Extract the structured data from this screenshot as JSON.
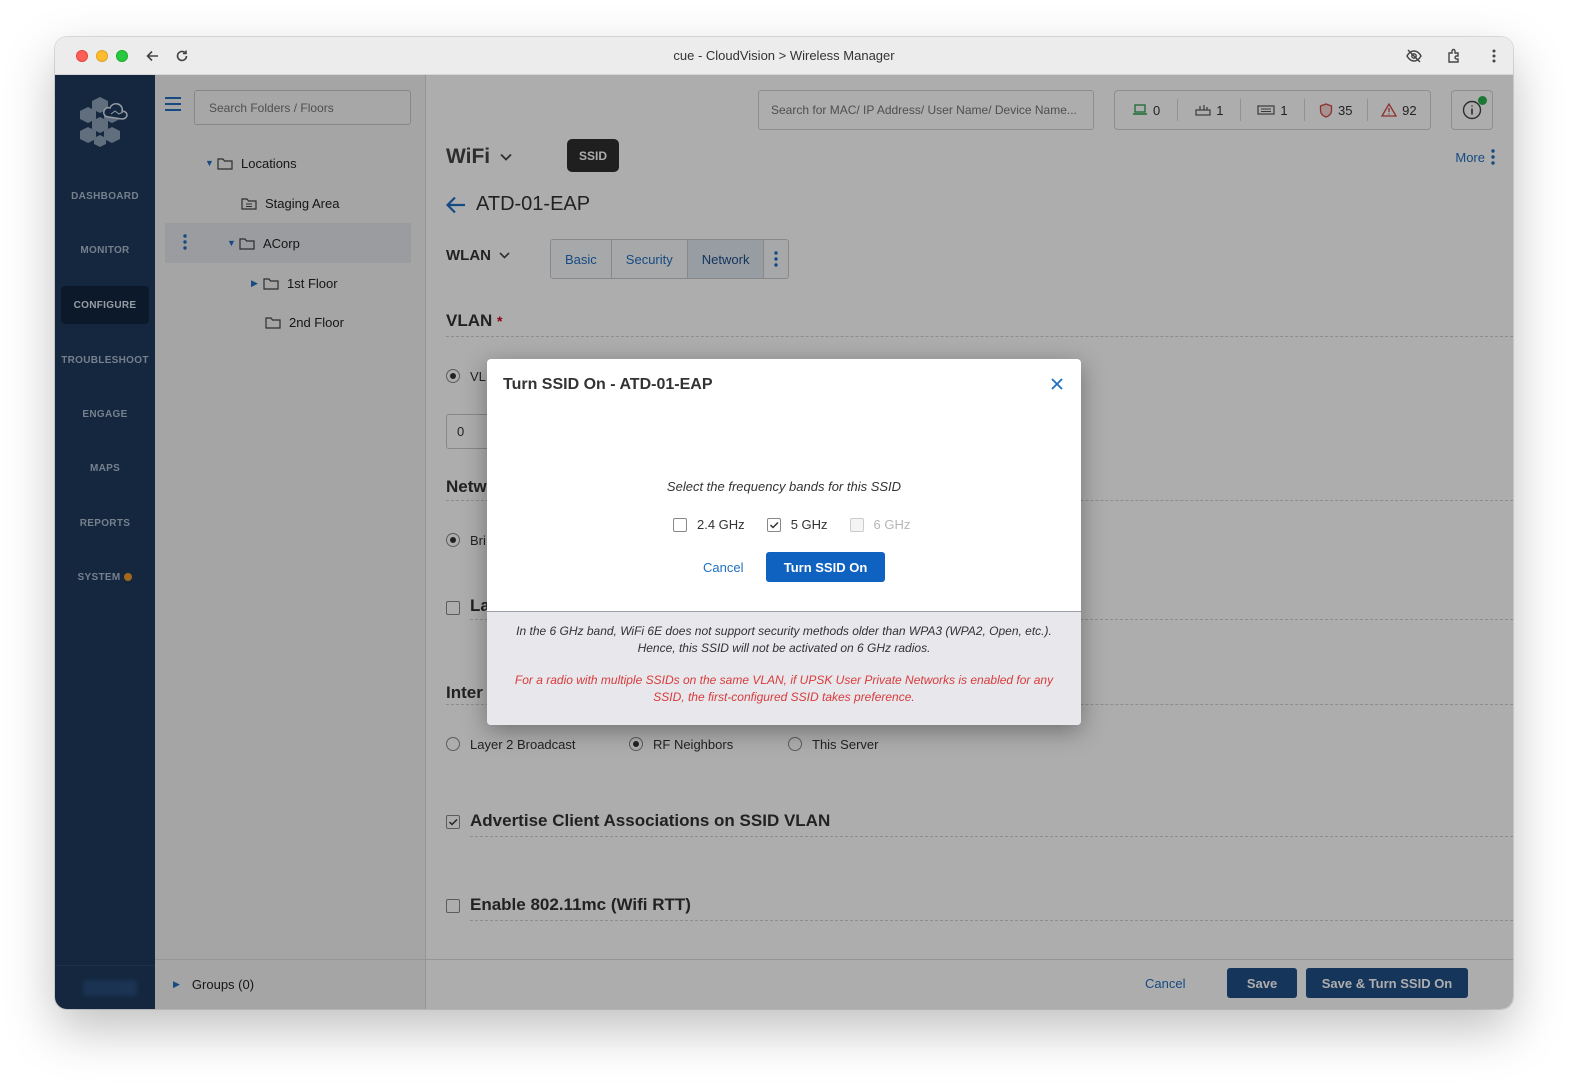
{
  "window": {
    "title": "cue - CloudVision > Wireless Manager"
  },
  "nav": {
    "items": [
      "DASHBOARD",
      "MONITOR",
      "CONFIGURE",
      "TROUBLESHOOT",
      "ENGAGE",
      "MAPS",
      "REPORTS",
      "SYSTEM"
    ],
    "active": "CONFIGURE"
  },
  "tree": {
    "search_placeholder": "Search Folders / Floors",
    "items": [
      {
        "label": "Locations"
      },
      {
        "label": "Staging Area"
      },
      {
        "label": "ACorp"
      },
      {
        "label": "1st Floor"
      },
      {
        "label": "2nd Floor"
      }
    ],
    "groups_label": "Groups (0)"
  },
  "header": {
    "search_placeholder": "Search for MAC/ IP Address/ User Name/ Device Name...",
    "stats": [
      "0",
      "1",
      "1",
      "35",
      "92"
    ]
  },
  "page": {
    "wifi_label": "WiFi",
    "ssid_badge": "SSID",
    "more_label": "More",
    "ssid_name": "ATD-01-EAP",
    "wlan_label": "WLAN",
    "tabs": [
      "Basic",
      "Security",
      "Network"
    ],
    "active_tab": "Network",
    "vlan_section": "VLAN",
    "vlan_radio_label": "VL",
    "vlan_value": "0",
    "network_section": "Netw",
    "bridge_label": "Bri",
    "la_label": "La",
    "inter_section": "Inter",
    "roaming_options": [
      "Layer 2 Broadcast",
      "RF Neighbors",
      "This Server"
    ],
    "advertise_label": "Advertise Client Associations on SSID VLAN",
    "rtt_label": "Enable 802.11mc (Wifi RTT)"
  },
  "footer": {
    "cancel": "Cancel",
    "save": "Save",
    "save_turn_on": "Save & Turn SSID On"
  },
  "modal": {
    "title": "Turn SSID On - ATD-01-EAP",
    "prompt": "Select the frequency bands for this SSID",
    "bands": [
      {
        "label": "2.4 GHz",
        "checked": false,
        "disabled": false
      },
      {
        "label": "5 GHz",
        "checked": true,
        "disabled": false
      },
      {
        "label": "6 GHz",
        "checked": false,
        "disabled": true
      }
    ],
    "cancel": "Cancel",
    "confirm": "Turn SSID On",
    "note_1": "In the 6 GHz band, WiFi 6E does not support security methods older than WPA3 (WPA2, Open, etc.). Hence, this SSID will not be activated on 6 GHz radios.",
    "note_2": "For a radio with multiple SSIDs on the same VLAN, if UPSK User Private Networks is enabled for any SSID, the first-configured SSID takes preference."
  },
  "colors": {
    "nav_bg": "#1e3a5c",
    "accent": "#1f6fc0",
    "primary_button": "#0f62c0",
    "warning_text": "#d93b3b"
  }
}
